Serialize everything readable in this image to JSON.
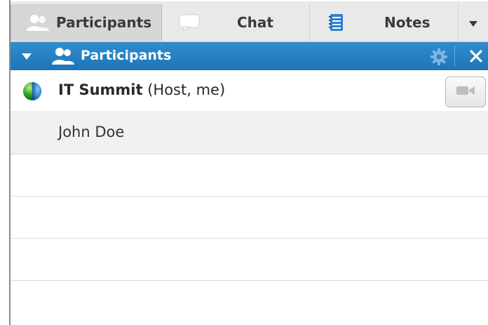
{
  "tabs": {
    "participants_label": "Participants",
    "chat_label": "Chat",
    "notes_label": "Notes",
    "more_icon": "chevron-down-icon"
  },
  "panel": {
    "title": "Participants",
    "icons": [
      "collapse-triangle-icon",
      "people-icon",
      "gear-icon",
      "close-icon"
    ]
  },
  "participants": [
    {
      "name": "IT Summit",
      "role": "(Host, me)",
      "icon": "globe-icon",
      "has_camera_button": true
    },
    {
      "name": "John Doe"
    }
  ],
  "colors": {
    "header_blue": "#1f74b6",
    "tab_bg": "#e9e9e9",
    "active_tab_bg": "#d6d6d6",
    "row_alt": "#f1f1f1"
  }
}
